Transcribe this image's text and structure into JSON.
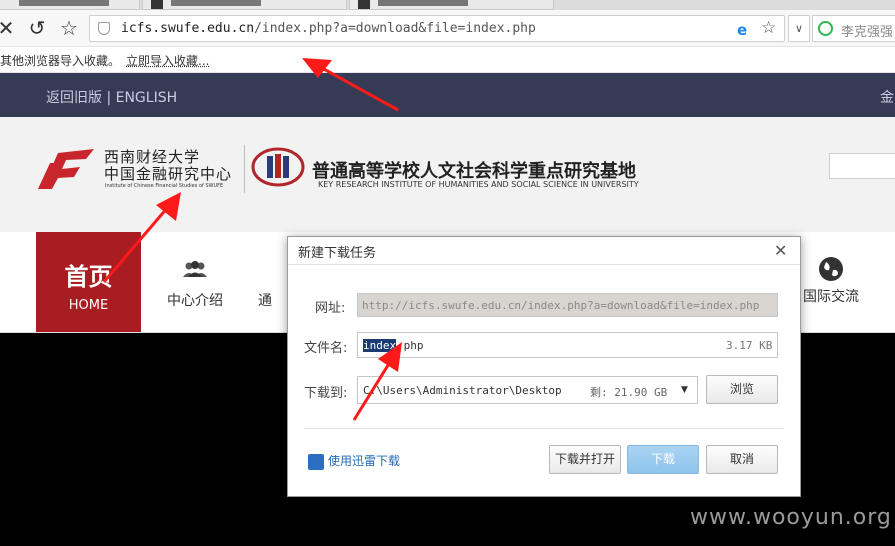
{
  "browser": {
    "tabs": [
      {
        "title": ""
      },
      {
        "title": ""
      },
      {
        "title": ""
      }
    ],
    "address": {
      "host": "icfs.swufe.edu.cn",
      "path": "/index.php?a=download&file=index.php"
    },
    "search_value": "李克强强",
    "favbar": {
      "import_text": "其他浏览器导入收藏。",
      "import_link": "立即导入收藏..."
    }
  },
  "site": {
    "topbar_links": "返回旧版 | ENGLISH",
    "topbar_right": "金",
    "university_name_line1": "西南财经大学",
    "university_name_line2": "中国金融研究中心",
    "university_name_en": "Institute of Chinese Financial Studies of SWUFE",
    "base_title": "普通高等学校人文社会科学重点研究基地",
    "base_title_en": "KEY RESEARCH INSTITUTE OF HUMANITIES AND SOCIAL SCIENCE IN UNIVERSITY",
    "nav": {
      "home_zh": "首页",
      "home_en": "HOME",
      "items": [
        {
          "label": "中心介绍",
          "icon": "people-icon"
        },
        {
          "label": "通",
          "icon": ""
        },
        {
          "label": "国际交流",
          "icon": "globe-icon"
        }
      ]
    },
    "watermark": "www.wooyun.org"
  },
  "dialog": {
    "title": "新建下载任务",
    "url_label": "网址:",
    "url_value": "http://icfs.swufe.edu.cn/index.php?a=download&file=index.php",
    "filename_label": "文件名:",
    "filename_selected": "index",
    "filename_ext": ".php",
    "filesize": "3.17 KB",
    "saveto_label": "下载到:",
    "saveto_path": "C:\\Users\\Administrator\\Desktop",
    "free_space": "剩: 21.90 GB",
    "browse_label": "浏览",
    "xunlei_label": "使用迅雷下载",
    "download_open_label": "下载并打开",
    "download_label": "下载",
    "cancel_label": "取消"
  },
  "colors": {
    "topbar": "#363b55",
    "home_tile": "#a81c22",
    "annotation_arrow": "#ff1a1a",
    "primary_button": "#8fc4ec"
  }
}
